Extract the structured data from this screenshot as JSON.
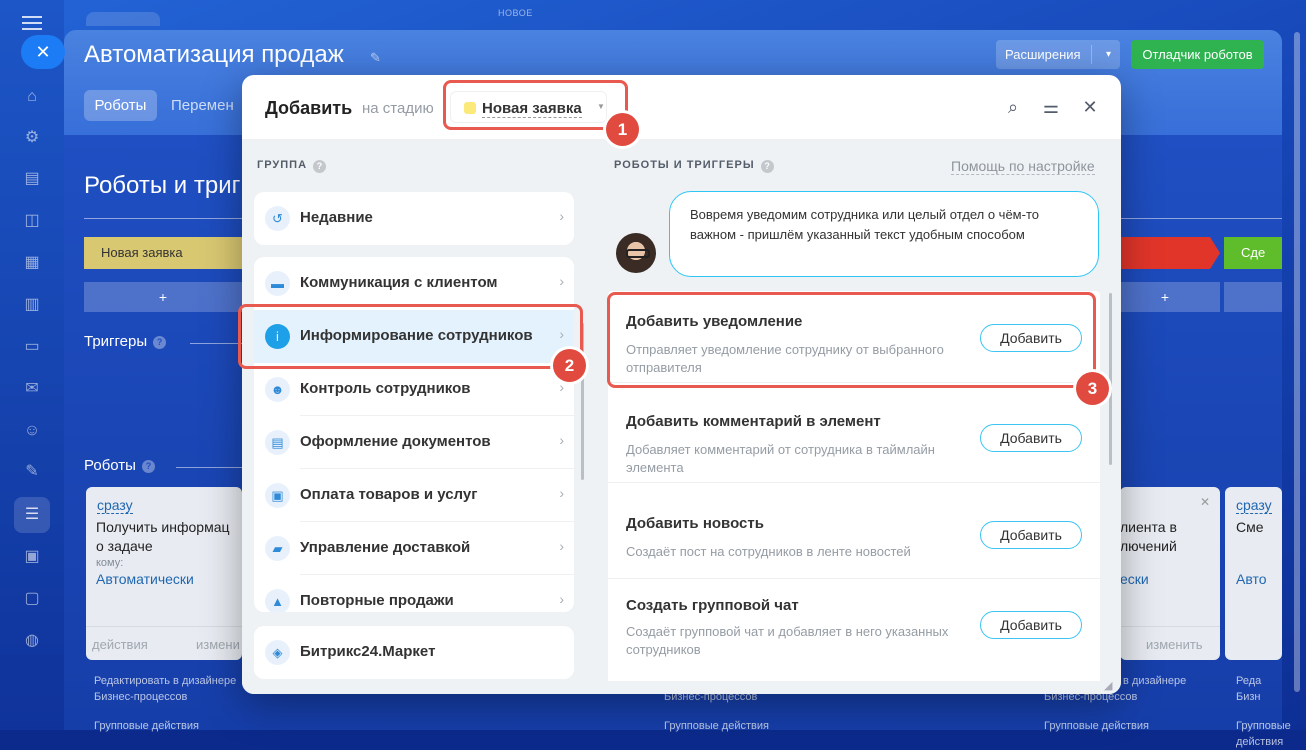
{
  "header": {
    "new_label": "НОВОЕ",
    "title": "Автоматизация продаж",
    "extensions_label": "Расширения",
    "debugger_label": "Отладчик роботов",
    "tabs": [
      {
        "label": "Роботы"
      },
      {
        "label": "Перемен"
      }
    ]
  },
  "page": {
    "section_title": "Роботы и триг",
    "stage_first": "Новая заявка",
    "stage_last": "Сде",
    "triggers_label": "Триггеры",
    "robots_label": "Роботы",
    "plus": "+",
    "card_left": {
      "link": "сразу",
      "title_line1": "Получить информац",
      "title_line2": "о задаче",
      "key": "кому:",
      "value": "Автоматически",
      "foot_left": "действия",
      "foot_right": "измени"
    },
    "card_mid": {
      "title_line1": "лиента в",
      "title_line2": "лючений",
      "value": "ески",
      "foot_right": "изменить"
    },
    "card_right": {
      "link": "сразу",
      "title": "Сме",
      "value": "Авто"
    },
    "below_left": "Редактировать в дизайнере\nБизнес-процессов",
    "below_mid": "Бизнес-процессов",
    "below_right": "Редактировать в дизайнере\nБизнес-процессов",
    "below_far": "Реда\nБизн",
    "group_actions": "Групповые действия"
  },
  "modal": {
    "title": "Добавить",
    "subtitle": "на стадию",
    "stage_name": "Новая заявка",
    "group_header": "ГРУППА",
    "robots_header": "РОБОТЫ И ТРИГГЕРЫ",
    "help_link": "Помощь по настройке",
    "groups": [
      {
        "label": "Недавние",
        "icon": "history-icon"
      },
      {
        "label": "Коммуникация с клиентом",
        "icon": "chat-icon"
      },
      {
        "label": "Информирование сотрудников",
        "icon": "info-icon"
      },
      {
        "label": "Контроль сотрудников",
        "icon": "people-icon"
      },
      {
        "label": "Оформление документов",
        "icon": "document-icon"
      },
      {
        "label": "Оплата товаров и услуг",
        "icon": "wallet-icon"
      },
      {
        "label": "Управление доставкой",
        "icon": "truck-icon"
      },
      {
        "label": "Повторные продажи",
        "icon": "repeat-sales-icon"
      },
      {
        "label": "Битрикс24.Маркет",
        "icon": "market-icon"
      }
    ],
    "bubble": "Вовремя уведомим сотрудника или целый отдел о чём-то важном - пришлём указанный текст удобным способом",
    "robots": [
      {
        "title": "Добавить уведомление",
        "desc": "Отправляет уведомление сотруднику от выбранного отправителя",
        "button": "Добавить"
      },
      {
        "title": "Добавить комментарий в элемент",
        "desc": "Добавляет комментарий от сотрудника в таймлайн элемента",
        "button": "Добавить"
      },
      {
        "title": "Добавить новость",
        "desc": "Создаёт пост на сотрудников в ленте новостей",
        "button": "Добавить"
      },
      {
        "title": "Создать групповой чат",
        "desc": "Создаёт групповой чат и добавляет в него указанных сотрудников",
        "button": "Добавить"
      }
    ]
  },
  "callouts": [
    "1",
    "2",
    "3"
  ],
  "colors": {
    "accent_blue": "#2fc6f6",
    "highlight_red": "#e85a4f",
    "stage_yellow": "#d9c872",
    "debug_green": "#2fb350"
  }
}
